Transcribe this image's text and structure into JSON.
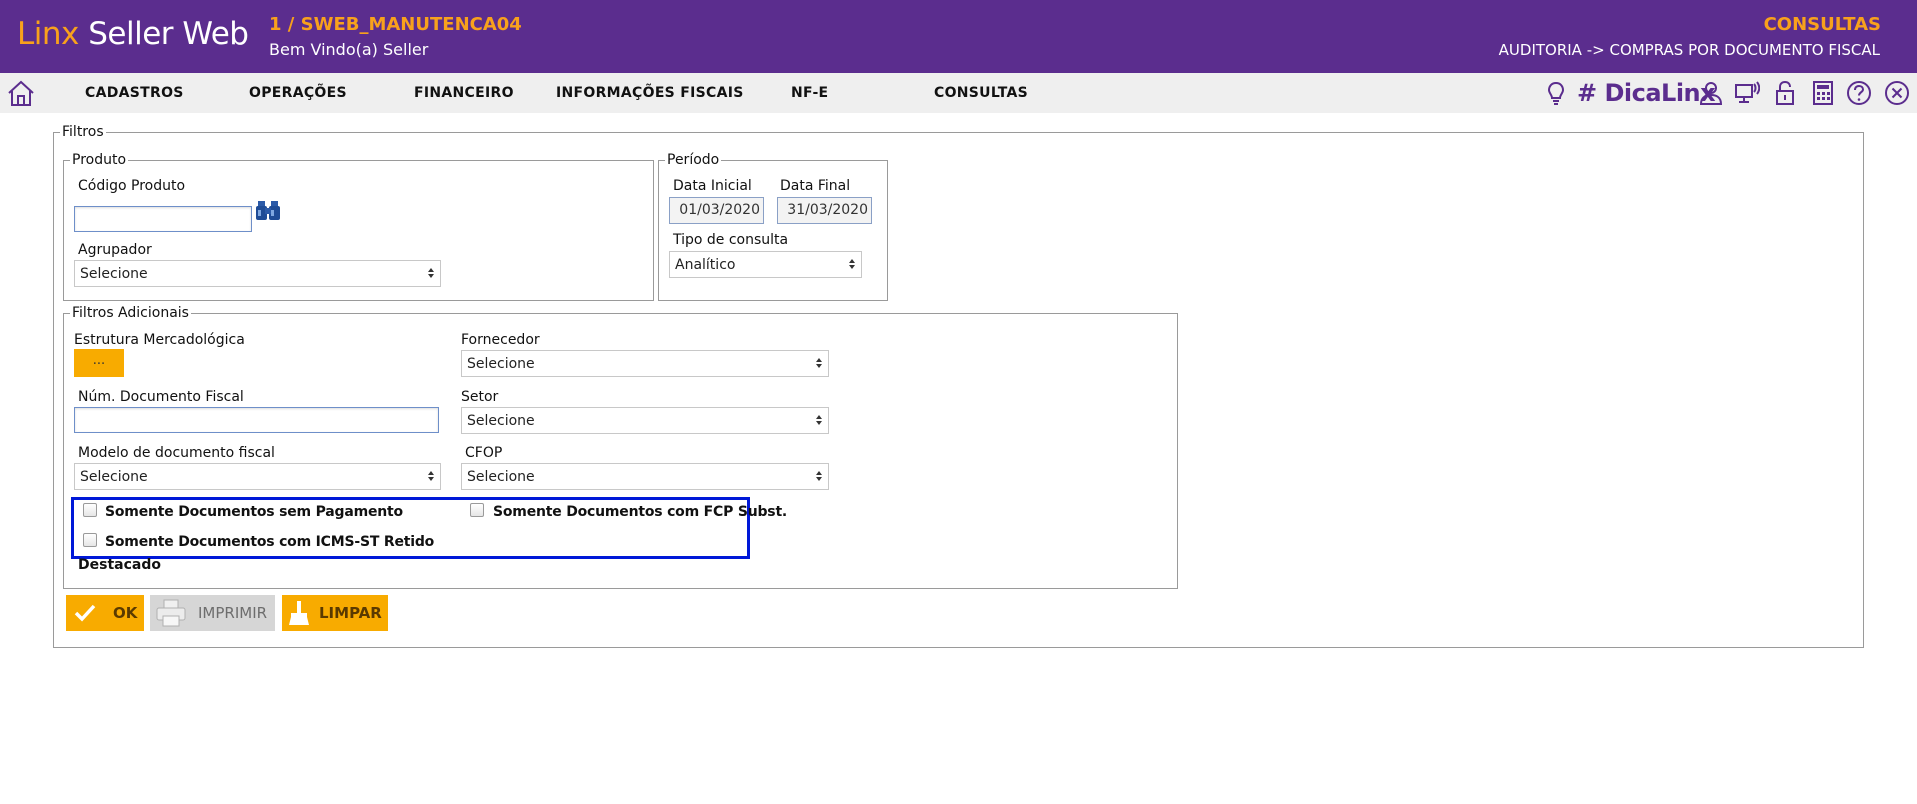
{
  "header": {
    "logo_linx": "Linx",
    "logo_seller": "Seller Web",
    "store": "1 / SWEB_MANUTENCA04",
    "welcome": "Bem Vindo(a) Seller",
    "section": "CONSULTAS",
    "breadcrumb": "AUDITORIA -> COMPRAS POR DOCUMENTO FISCAL"
  },
  "menu": {
    "items": [
      "CADASTROS",
      "OPERAÇÕES",
      "FINANCEIRO",
      "INFORMAÇÕES FISCAIS",
      "NF-E",
      "CONSULTAS"
    ],
    "dica": "# DicaLinx",
    "tools": [
      "lightbulb-icon",
      "user-icon",
      "remote-access-icon",
      "lock-icon",
      "calculator-icon",
      "help-icon",
      "close-icon"
    ]
  },
  "filtros": {
    "legend": "Filtros",
    "produto": {
      "legend": "Produto",
      "codigo_label": "Código Produto",
      "codigo_value": "",
      "agrupador_label": "Agrupador",
      "agrupador_value": "Selecione"
    },
    "periodo": {
      "legend": "Período",
      "data_inicial_label": "Data Inicial",
      "data_inicial_value": "01/03/2020",
      "data_final_label": "Data Final",
      "data_final_value": "31/03/2020",
      "tipo_label": "Tipo de consulta",
      "tipo_value": "Analítico"
    },
    "adicionais": {
      "legend": "Filtros Adicionais",
      "estrutura_label": "Estrutura Mercadológica",
      "estrutura_button": "...",
      "fornecedor_label": "Fornecedor",
      "fornecedor_value": "Selecione",
      "num_doc_label": "Núm. Documento Fiscal",
      "num_doc_value": "",
      "setor_label": "Setor",
      "setor_value": "Selecione",
      "modelo_label": "Modelo de documento fiscal",
      "modelo_value": "Selecione",
      "cfop_label": "CFOP",
      "cfop_value": "Selecione",
      "cb_sem_pagamento": "Somente Documentos sem Pagamento",
      "cb_fcp_subst": "Somente Documentos com FCP Subst.",
      "cb_icms_st": "Somente Documentos com ICMS-ST Retido",
      "destacado": "Destacado"
    }
  },
  "actions": {
    "ok": "OK",
    "imprimir": "IMPRIMIR",
    "limpar": "LIMPAR"
  },
  "colors": {
    "brand_purple": "#5b2d8e",
    "brand_orange": "#f8a11c",
    "button_yellow": "#f8ab00",
    "highlight_blue": "#0018d8"
  }
}
